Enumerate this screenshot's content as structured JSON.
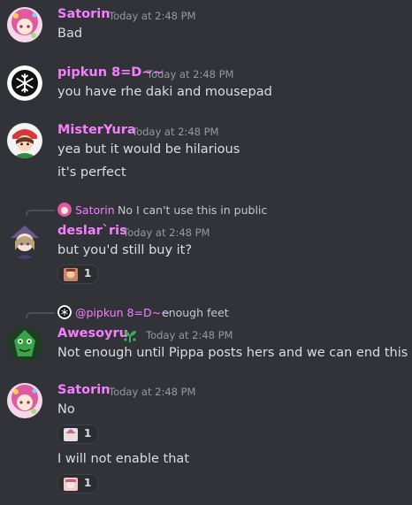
{
  "colors": {
    "background": "#313338",
    "pink_name": "#f47fff",
    "timestamp": "#949ba4",
    "message_text": "#dbdee1",
    "reaction_bg": "#2b2d31"
  },
  "messages": [
    {
      "author": "Satorin",
      "timestamp": "Today at 2:48 PM",
      "lines": [
        "Bad"
      ]
    },
    {
      "author": "pipkun 8=D~~",
      "timestamp": "Today at 2:48 PM",
      "lines": [
        "you have rhe daki and mousepad"
      ]
    },
    {
      "author": "MisterYura",
      "timestamp": "Today at 2:48 PM",
      "lines": [
        "yea but it would be hilarious",
        "it's perfect"
      ]
    },
    {
      "reply": {
        "author": "Satorin",
        "text": "No I can't use this in public"
      },
      "author": "deslar`ris",
      "timestamp": "Today at 2:48 PM",
      "lines": [
        "but you'd still buy it?"
      ],
      "reaction_count": "1"
    },
    {
      "reply": {
        "author": "@pipkun 8=D~~",
        "text": "enough feet"
      },
      "author": "Awesoyru",
      "badge_icon": "sprout-icon",
      "timestamp": "Today at 2:48 PM",
      "lines": [
        "Not enough until Pippa posts hers and we can end this arc"
      ]
    },
    {
      "author": "Satorin",
      "timestamp": "Today at 2:48 PM",
      "lines": [
        "No",
        "I will not enable that"
      ],
      "reaction_counts": [
        "1",
        "1"
      ]
    }
  ]
}
